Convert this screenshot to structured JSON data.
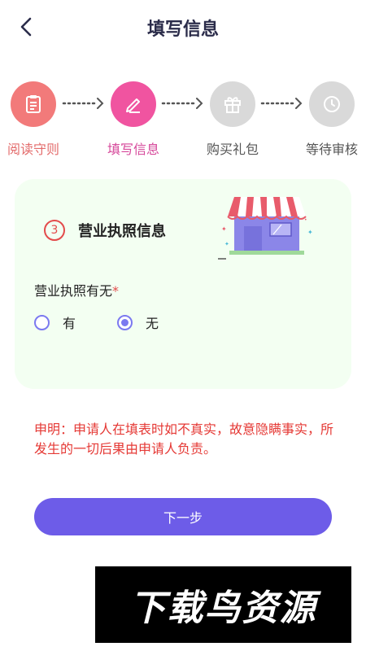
{
  "header": {
    "title": "填写信息"
  },
  "steps": [
    {
      "label": "阅读守则",
      "icon": "clipboard-icon",
      "circle_color": "#f27a7a",
      "label_color": "#e36b6b"
    },
    {
      "label": "填写信息",
      "icon": "pen-icon",
      "circle_color": "#f054a0",
      "label_color": "#d6479a"
    },
    {
      "label": "购买礼包",
      "icon": "gift-icon",
      "circle_color": "#d9d9d9",
      "label_color": "#555555"
    },
    {
      "label": "等待审核",
      "icon": "clock-icon",
      "circle_color": "#d9d9d9",
      "label_color": "#555555"
    }
  ],
  "section": {
    "number": "3",
    "title": "营业执照信息",
    "illustration": "shop-storefront-icon"
  },
  "license_field": {
    "label": "营业执照有无",
    "required_mark": "*",
    "options": [
      {
        "label": "有",
        "selected": false
      },
      {
        "label": "无",
        "selected": true
      }
    ]
  },
  "disclaimer": "申明：申请人在填表时如不真实，故意隐瞒事实，所发生的一切后果由申请人负责。",
  "next_button": {
    "label": "下一步"
  },
  "watermark": {
    "text": "下载鸟资源"
  },
  "colors": {
    "accent": "#6d5ce8",
    "card_bg": "#f3fff2",
    "warning": "#e53935",
    "radio": "#7b79f0"
  }
}
